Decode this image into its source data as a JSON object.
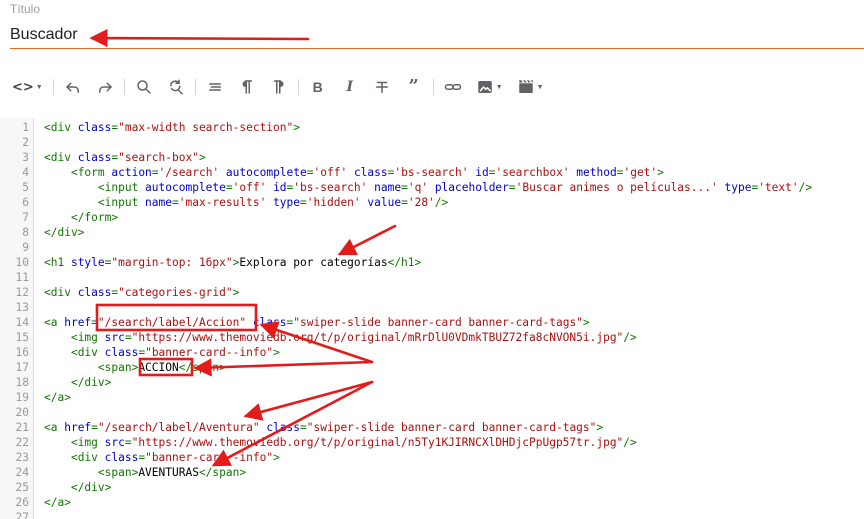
{
  "title_field": {
    "label": "Título",
    "value": "Buscador"
  },
  "toolbar": {
    "buttons": [
      {
        "name": "code-view",
        "icon": "code-icon",
        "has_dropdown": true
      },
      {
        "name": "undo",
        "icon": "undo-icon"
      },
      {
        "name": "redo",
        "icon": "redo-icon"
      },
      {
        "name": "search",
        "icon": "search-icon"
      },
      {
        "name": "replace",
        "icon": "find-replace-icon"
      },
      {
        "name": "align",
        "icon": "align-icon"
      },
      {
        "name": "paragraph",
        "icon": "pilcrow-icon"
      },
      {
        "name": "paragraph-rtl",
        "icon": "pilcrow-rtl-icon"
      },
      {
        "name": "bold",
        "icon": "bold-icon"
      },
      {
        "name": "italic",
        "icon": "italic-icon"
      },
      {
        "name": "strikethrough",
        "icon": "strikethrough-icon"
      },
      {
        "name": "quote",
        "icon": "quote-icon"
      },
      {
        "name": "link",
        "icon": "link-icon"
      },
      {
        "name": "image",
        "icon": "image-icon",
        "has_dropdown": true
      },
      {
        "name": "video",
        "icon": "video-icon",
        "has_dropdown": true
      }
    ]
  },
  "editor": {
    "lines": [
      {
        "n": "1",
        "code": [
          [
            "t",
            "<div "
          ],
          [
            "a",
            "class"
          ],
          [
            "t",
            "="
          ],
          [
            "s",
            "\"max-width search-section\""
          ],
          [
            "t",
            ">"
          ]
        ]
      },
      {
        "n": "2",
        "code": []
      },
      {
        "n": "3",
        "code": [
          [
            "t",
            "<div "
          ],
          [
            "a",
            "class"
          ],
          [
            "t",
            "="
          ],
          [
            "s",
            "\"search-box\""
          ],
          [
            "t",
            ">"
          ]
        ]
      },
      {
        "n": "4",
        "code": [
          [
            "tx",
            "    "
          ],
          [
            "t",
            "<form "
          ],
          [
            "a",
            "action"
          ],
          [
            "t",
            "="
          ],
          [
            "s",
            "'/search'"
          ],
          [
            "tx",
            " "
          ],
          [
            "a",
            "autocomplete"
          ],
          [
            "t",
            "="
          ],
          [
            "s",
            "'off'"
          ],
          [
            "tx",
            " "
          ],
          [
            "a",
            "class"
          ],
          [
            "t",
            "="
          ],
          [
            "s",
            "'bs-search'"
          ],
          [
            "tx",
            " "
          ],
          [
            "a",
            "id"
          ],
          [
            "t",
            "="
          ],
          [
            "s",
            "'searchbox'"
          ],
          [
            "tx",
            " "
          ],
          [
            "a",
            "method"
          ],
          [
            "t",
            "="
          ],
          [
            "s",
            "'get'"
          ],
          [
            "t",
            ">"
          ]
        ]
      },
      {
        "n": "5",
        "code": [
          [
            "tx",
            "        "
          ],
          [
            "t",
            "<input "
          ],
          [
            "a",
            "autocomplete"
          ],
          [
            "t",
            "="
          ],
          [
            "s",
            "'off'"
          ],
          [
            "tx",
            " "
          ],
          [
            "a",
            "id"
          ],
          [
            "t",
            "="
          ],
          [
            "s",
            "'bs-search'"
          ],
          [
            "tx",
            " "
          ],
          [
            "a",
            "name"
          ],
          [
            "t",
            "="
          ],
          [
            "s",
            "'q'"
          ],
          [
            "tx",
            " "
          ],
          [
            "a",
            "placeholder"
          ],
          [
            "t",
            "="
          ],
          [
            "s",
            "'Buscar animes o películas...'"
          ],
          [
            "tx",
            " "
          ],
          [
            "a",
            "type"
          ],
          [
            "t",
            "="
          ],
          [
            "s",
            "'text'"
          ],
          [
            "t",
            "/>"
          ]
        ]
      },
      {
        "n": "6",
        "code": [
          [
            "tx",
            "        "
          ],
          [
            "t",
            "<input "
          ],
          [
            "a",
            "name"
          ],
          [
            "t",
            "="
          ],
          [
            "s",
            "'max-results'"
          ],
          [
            "tx",
            " "
          ],
          [
            "a",
            "type"
          ],
          [
            "t",
            "="
          ],
          [
            "s",
            "'hidden'"
          ],
          [
            "tx",
            " "
          ],
          [
            "a",
            "value"
          ],
          [
            "t",
            "="
          ],
          [
            "s",
            "'28'"
          ],
          [
            "t",
            "/>"
          ]
        ]
      },
      {
        "n": "7",
        "code": [
          [
            "tx",
            "    "
          ],
          [
            "t",
            "</form>"
          ]
        ]
      },
      {
        "n": "8",
        "code": [
          [
            "t",
            "</div>"
          ]
        ]
      },
      {
        "n": "9",
        "code": []
      },
      {
        "n": "10",
        "code": [
          [
            "t",
            "<h1 "
          ],
          [
            "a",
            "style"
          ],
          [
            "t",
            "="
          ],
          [
            "s",
            "\"margin-top: 16px\""
          ],
          [
            "t",
            ">"
          ],
          [
            "tx",
            "Explora por categorías"
          ],
          [
            "t",
            "</h1>"
          ]
        ]
      },
      {
        "n": "11",
        "code": []
      },
      {
        "n": "12",
        "code": [
          [
            "t",
            "<div "
          ],
          [
            "a",
            "class"
          ],
          [
            "t",
            "="
          ],
          [
            "s",
            "\"categories-grid\""
          ],
          [
            "t",
            ">"
          ]
        ]
      },
      {
        "n": "13",
        "code": []
      },
      {
        "n": "14",
        "code": [
          [
            "t",
            "<a "
          ],
          [
            "a",
            "href"
          ],
          [
            "t",
            "="
          ],
          [
            "s",
            "\"/search/label/Accion\""
          ],
          [
            "tx",
            " "
          ],
          [
            "a",
            "class"
          ],
          [
            "t",
            "="
          ],
          [
            "s",
            "\"swiper-slide banner-card banner-card-tags\""
          ],
          [
            "t",
            ">"
          ]
        ]
      },
      {
        "n": "15",
        "code": [
          [
            "tx",
            "    "
          ],
          [
            "t",
            "<img "
          ],
          [
            "a",
            "src"
          ],
          [
            "t",
            "="
          ],
          [
            "s",
            "\"https://www.themoviedb.org/t/p/original/mRrDlU0VDmkTBUZ72fa8cNVON5i.jpg\""
          ],
          [
            "t",
            "/>"
          ]
        ]
      },
      {
        "n": "16",
        "code": [
          [
            "tx",
            "    "
          ],
          [
            "t",
            "<div "
          ],
          [
            "a",
            "class"
          ],
          [
            "t",
            "="
          ],
          [
            "s",
            "\"banner-card--info\""
          ],
          [
            "t",
            ">"
          ]
        ]
      },
      {
        "n": "17",
        "code": [
          [
            "tx",
            "        "
          ],
          [
            "t",
            "<span>"
          ],
          [
            "tx",
            "ACCION"
          ],
          [
            "t",
            "</span>"
          ]
        ]
      },
      {
        "n": "18",
        "code": [
          [
            "tx",
            "    "
          ],
          [
            "t",
            "</div>"
          ]
        ]
      },
      {
        "n": "19",
        "code": [
          [
            "t",
            "</a>"
          ]
        ]
      },
      {
        "n": "20",
        "code": []
      },
      {
        "n": "21",
        "code": [
          [
            "t",
            "<a "
          ],
          [
            "a",
            "href"
          ],
          [
            "t",
            "="
          ],
          [
            "s",
            "\"/search/label/Aventura\""
          ],
          [
            "tx",
            " "
          ],
          [
            "a",
            "class"
          ],
          [
            "t",
            "="
          ],
          [
            "s",
            "\"swiper-slide banner-card banner-card-tags\""
          ],
          [
            "t",
            ">"
          ]
        ]
      },
      {
        "n": "22",
        "code": [
          [
            "tx",
            "    "
          ],
          [
            "t",
            "<img "
          ],
          [
            "a",
            "src"
          ],
          [
            "t",
            "="
          ],
          [
            "s",
            "\"https://www.themoviedb.org/t/p/original/n5Ty1KJIRNCXlDHDjcPpUgp57tr.jpg\""
          ],
          [
            "t",
            "/>"
          ]
        ]
      },
      {
        "n": "23",
        "code": [
          [
            "tx",
            "    "
          ],
          [
            "t",
            "<div "
          ],
          [
            "a",
            "class"
          ],
          [
            "t",
            "="
          ],
          [
            "s",
            "\"banner-card--info\""
          ],
          [
            "t",
            ">"
          ]
        ]
      },
      {
        "n": "24",
        "code": [
          [
            "tx",
            "        "
          ],
          [
            "t",
            "<span>"
          ],
          [
            "tx",
            "AVENTURAS"
          ],
          [
            "t",
            "</span>"
          ]
        ]
      },
      {
        "n": "25",
        "code": [
          [
            "tx",
            "    "
          ],
          [
            "t",
            "</div>"
          ]
        ]
      },
      {
        "n": "26",
        "code": [
          [
            "t",
            "</a>"
          ]
        ]
      },
      {
        "n": "27",
        "code": []
      }
    ]
  },
  "annotation_color": "#e31b1b"
}
